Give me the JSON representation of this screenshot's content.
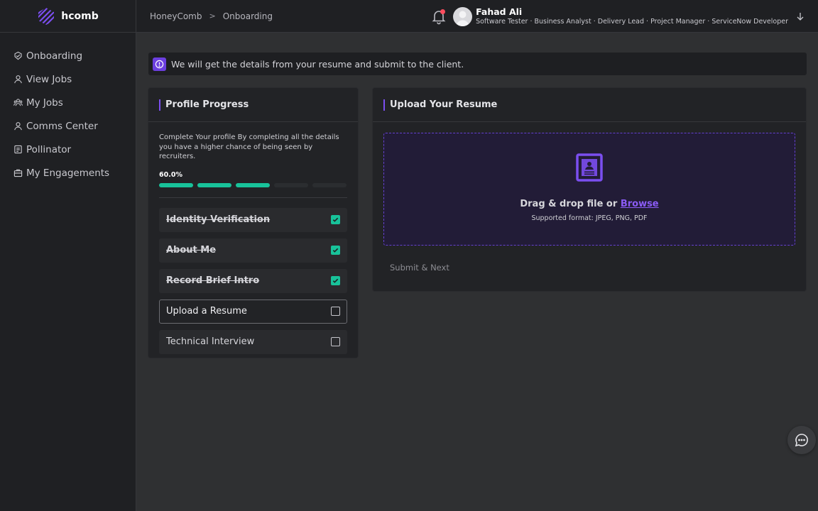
{
  "brand": {
    "name": "hcomb"
  },
  "sidebar": {
    "items": [
      {
        "label": "Onboarding",
        "icon": "badge-icon"
      },
      {
        "label": "View Jobs",
        "icon": "user-icon"
      },
      {
        "label": "My Jobs",
        "icon": "users-icon"
      },
      {
        "label": "Comms Center",
        "icon": "user-icon"
      },
      {
        "label": "Pollinator",
        "icon": "document-icon"
      },
      {
        "label": "My Engagements",
        "icon": "briefcase-icon"
      }
    ]
  },
  "header": {
    "breadcrumb": [
      "HoneyComb",
      "Onboarding"
    ],
    "separator": ">",
    "user": {
      "name": "Fahad Ali",
      "roles": "Software Tester · Business Analyst · Delivery Lead · Project Manager · ServiceNow Developer"
    }
  },
  "alert": {
    "text": "We will get the details from your resume and submit to the client."
  },
  "progress": {
    "title": "Profile Progress",
    "description": "Complete Your profile By completing all the details you have a higher chance of being seen by recruiters.",
    "percent_label": "60.0%",
    "percent": 60,
    "segments_total": 5,
    "segments_done": 3,
    "steps": [
      {
        "label": "Identity Verification",
        "done": true
      },
      {
        "label": "About Me",
        "done": true
      },
      {
        "label": "Record Brief Intro",
        "done": true
      },
      {
        "label": "Upload a Resume",
        "done": false,
        "active": true
      },
      {
        "label": "Technical Interview",
        "done": false
      }
    ]
  },
  "upload": {
    "title": "Upload Your Resume",
    "dropzone_text": "Drag & drop file or",
    "browse_label": "Browse",
    "supported": "Supported format: JPEG, PNG, PDF",
    "submit_label": "Submit & Next"
  },
  "colors": {
    "accent": "#7b4ef0",
    "success": "#18c29a",
    "alert_dot": "#ff4d5e"
  }
}
